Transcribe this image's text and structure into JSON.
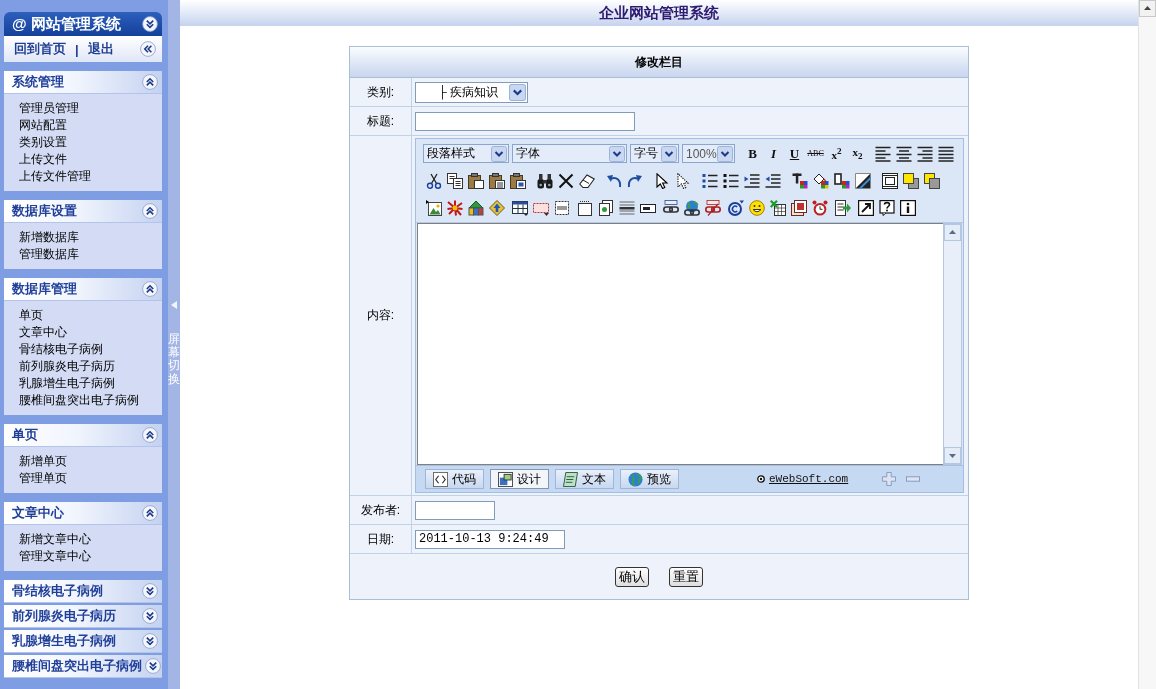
{
  "sidebar": {
    "title": "@ 网站管理系统",
    "links": [
      "回到首页",
      "退出"
    ],
    "link_separator": "|",
    "sections": [
      {
        "title": "系统管理",
        "expanded": true,
        "items": [
          "管理员管理",
          "网站配置",
          "类别设置",
          "上传文件",
          "上传文件管理"
        ]
      },
      {
        "title": "数据库设置",
        "expanded": true,
        "items": [
          "新增数据库",
          "管理数据库"
        ]
      },
      {
        "title": "数据库管理",
        "expanded": true,
        "items": [
          "单页",
          "文章中心",
          "骨结核电子病例",
          "前列腺炎电子病历",
          "乳腺增生电子病例",
          "腰椎间盘突出电子病例"
        ]
      },
      {
        "title": "单页",
        "expanded": true,
        "items": [
          "新增单页",
          "管理单页"
        ]
      },
      {
        "title": "文章中心",
        "expanded": true,
        "items": [
          "新增文章中心",
          "管理文章中心"
        ]
      },
      {
        "title": "骨结核电子病例",
        "expanded": false
      },
      {
        "title": "前列腺炎电子病历",
        "expanded": false
      },
      {
        "title": "乳腺增生电子病例",
        "expanded": false
      },
      {
        "title": "腰椎间盘突出电子病例",
        "expanded": false
      }
    ]
  },
  "screen_toggle": {
    "label": "屏幕切换"
  },
  "header": {
    "title": "企业网站管理系统"
  },
  "form": {
    "title": "修改栏目",
    "fields": [
      {
        "kind": "select",
        "label": "类别:",
        "value": "├ 疾病知识"
      },
      {
        "kind": "text",
        "label": "标题:"
      },
      {
        "kind": "editor",
        "label": "内容:",
        "dropdowns": [
          {
            "value": "段落样式"
          },
          {
            "value": "字体"
          },
          {
            "value": "字号"
          },
          {
            "value": "100%"
          }
        ],
        "format_buttons": [
          {
            "label": "B",
            "kind": "bold"
          },
          {
            "label": "I",
            "kind": "italic"
          },
          {
            "label": "U",
            "kind": "underline"
          },
          {
            "label": "ABC",
            "kind": "strikethrough"
          },
          {
            "label": "x$^{2}$",
            "kind": "superscript"
          },
          {
            "label": "x$_{2}$",
            "kind": "subscript"
          }
        ],
        "tabs": [
          {
            "label": "代码",
            "kind": "code",
            "selected": false
          },
          {
            "label": "设计",
            "kind": "design",
            "selected": true
          },
          {
            "label": "文本",
            "kind": "text",
            "selected": false
          },
          {
            "label": "预览",
            "kind": "preview",
            "selected": false
          }
        ],
        "credit": "eWebSoft.com"
      },
      {
        "kind": "text",
        "label": "发布者:"
      },
      {
        "kind": "text",
        "label": "日期:",
        "value": "2011-10-13 9:24:49"
      }
    ],
    "buttons": [
      "确认",
      "重置"
    ]
  }
}
